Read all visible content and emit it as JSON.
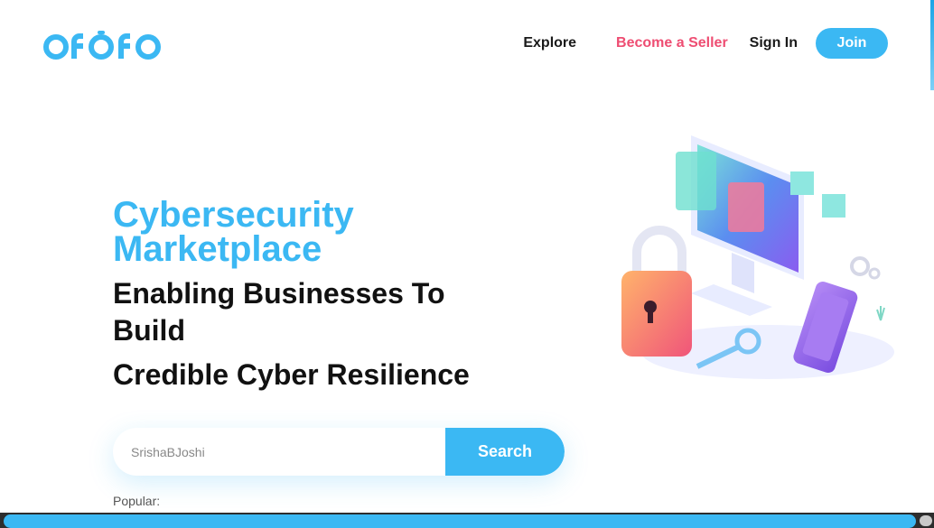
{
  "brand": {
    "logo_text": "ofofo",
    "accent": "#3bb8f3",
    "pink": "#ee4d72"
  },
  "nav": {
    "explore": "Explore",
    "become_seller": "Become a Seller",
    "sign_in": "Sign In",
    "join": "Join"
  },
  "hero": {
    "title_line1": "Cybersecurity",
    "title_line2": "Marketplace",
    "subtitle1": "Enabling Businesses To Build",
    "subtitle2": "Credible Cyber Resilience"
  },
  "search": {
    "value": "SrishaBJoshi",
    "button_label": "Search"
  },
  "popular_label": "Popular:",
  "illustration": {
    "icon": "cybersecurity-illustration"
  }
}
